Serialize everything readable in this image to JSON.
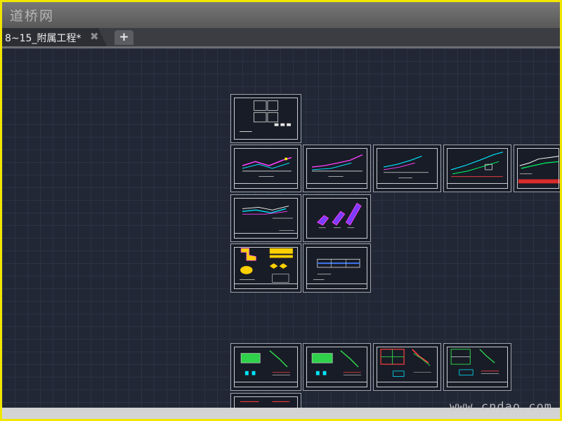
{
  "window": {
    "watermark_top": "道桥网"
  },
  "tabs": [
    {
      "label": "8~15_附属工程*",
      "active": true
    }
  ],
  "tab_controls": {
    "close_glyph": "✖",
    "add_glyph": "+"
  },
  "colors": {
    "canvas_background": "#212735",
    "grid_line": "#2b3242",
    "highlight_border": "#f2e600",
    "sheet_border": "#c9ccd3"
  },
  "watermark_bottom": "www.cndao.com"
}
